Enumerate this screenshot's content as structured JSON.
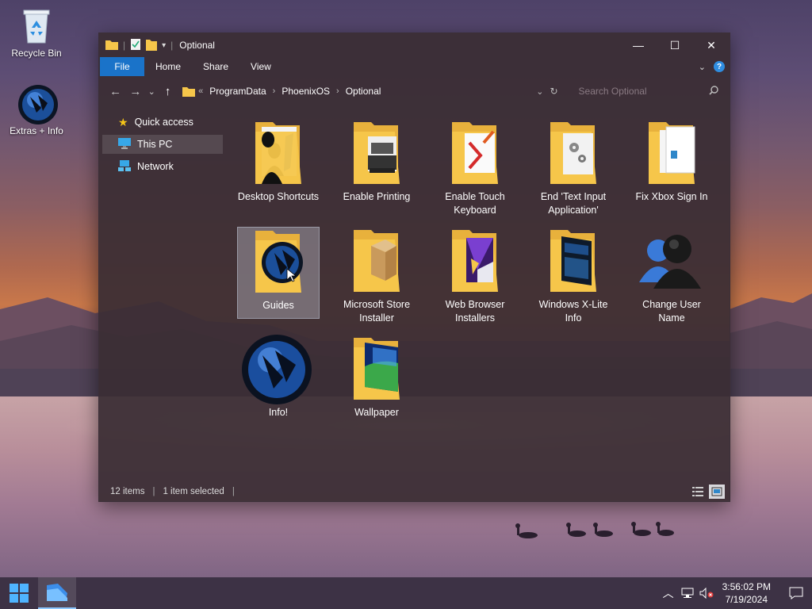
{
  "desktop": {
    "icons": [
      {
        "label": "Recycle Bin",
        "icon": "recycle-bin-icon"
      },
      {
        "label": "Extras + Info",
        "icon": "phoenix-orb-icon"
      }
    ]
  },
  "window": {
    "title": "Optional",
    "controls": {
      "minimize": "—",
      "maximize": "☐",
      "close": "✕"
    },
    "ribbon_tabs": [
      "File",
      "Home",
      "Share",
      "View"
    ],
    "breadcrumb": [
      "ProgramData",
      "PhoenixOS",
      "Optional"
    ],
    "breadcrumb_prefix": "«",
    "search_placeholder": "Search Optional",
    "nav_pane": [
      {
        "label": "Quick access",
        "icon": "star-icon"
      },
      {
        "label": "This PC",
        "icon": "monitor-icon",
        "selected": true
      },
      {
        "label": "Network",
        "icon": "network-icon"
      }
    ],
    "items": [
      {
        "label": "Desktop Shortcuts",
        "icon": "folder-shortcuts-icon"
      },
      {
        "label": "Enable Printing",
        "icon": "folder-printer-icon"
      },
      {
        "label": "Enable Touch Keyboard",
        "icon": "folder-keyboard-icon"
      },
      {
        "label": "End 'Text Input Application'",
        "icon": "folder-settings-icon"
      },
      {
        "label": "Fix Xbox Sign In",
        "icon": "folder-documents-icon"
      },
      {
        "label": "Guides",
        "icon": "folder-orb-icon",
        "selected": true
      },
      {
        "label": "Microsoft Store Installer",
        "icon": "folder-box-icon"
      },
      {
        "label": "Web Browser Installers",
        "icon": "folder-browser-icon"
      },
      {
        "label": "Windows X-Lite Info",
        "icon": "folder-info-icon"
      },
      {
        "label": "Change User Name",
        "icon": "users-icon"
      },
      {
        "label": "Info!",
        "icon": "phoenix-orb-icon"
      },
      {
        "label": "Wallpaper",
        "icon": "folder-wallpaper-icon"
      }
    ],
    "status": {
      "count": "12 items",
      "selection": "1 item selected"
    }
  },
  "taskbar": {
    "time": "3:56:02 PM",
    "date": "7/19/2024"
  },
  "colors": {
    "accent": "#1a73c9",
    "window_bg": "#3a2d34",
    "taskbar": "#3d3245"
  }
}
